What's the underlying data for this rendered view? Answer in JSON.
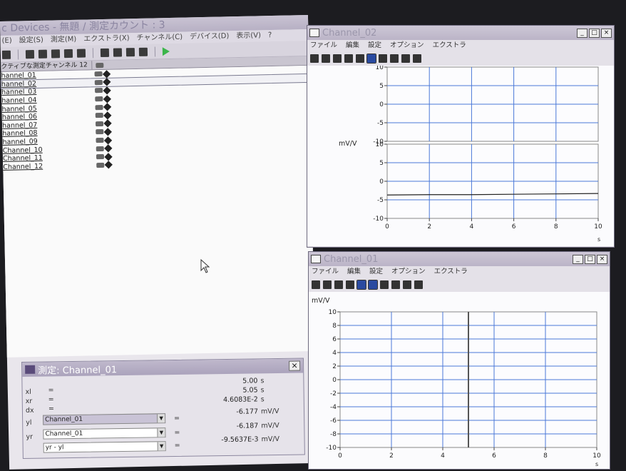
{
  "main": {
    "title": "c Devices - 無題 / 測定カウント : 3",
    "menu": [
      "(E)",
      "設定(S)",
      "測定(M)",
      "エクストラ(X)",
      "チャンネル(C)",
      "デバイス(D)",
      "表示(V)",
      "?"
    ],
    "list_header": "クティブな測定チャンネル 12",
    "channels": [
      "hannel_01",
      "hannel_02",
      "hannel_03",
      "hannel_04",
      "hannel_05",
      "hannel_06",
      "hannel_07",
      "hannel_08",
      "hannel_09",
      "Channel_10",
      "Channel_11",
      "Channel_12"
    ]
  },
  "measure": {
    "title": "測定: Channel_01",
    "close": "×",
    "rows": [
      {
        "label": "xl",
        "eq": "=",
        "value": "5.00",
        "unit": "s"
      },
      {
        "label": "xr",
        "eq": "=",
        "value": "5.05",
        "unit": "s"
      },
      {
        "label": "dx",
        "eq": "=",
        "value": "4.6083E-2",
        "unit": "s"
      }
    ],
    "yl": {
      "label": "yl",
      "channel": "Channel_01",
      "eq": "=",
      "value": "-6.177",
      "unit": "mV/V"
    },
    "yr": {
      "label": "yr",
      "channel": "Channel_01",
      "eq": "=",
      "value": "-6.187",
      "unit": "mV/V"
    },
    "diff": {
      "expr": "yr - yl",
      "eq": "=",
      "value": "-9.5637E-3",
      "unit": "mV/V"
    }
  },
  "ch02": {
    "title": "Channel_02",
    "menu": [
      "ファイル",
      "編集",
      "設定",
      "オプション",
      "エクストラ"
    ],
    "ylabel": "mV/V",
    "xlabel": "s",
    "buttons": [
      "_",
      "□",
      "×"
    ]
  },
  "ch01": {
    "title": "Channel_01",
    "menu": [
      "ファイル",
      "編集",
      "設定",
      "オプション",
      "エクストラ"
    ],
    "ylabel": "mV/V",
    "xlabel": "s",
    "buttons": [
      "_",
      "□",
      "×"
    ]
  },
  "chart_data": [
    {
      "type": "line",
      "panel": "Channel_02 upper",
      "ylabel": "",
      "ylim": [
        -10,
        10
      ],
      "yticks": [
        10,
        5,
        0,
        -5,
        -10
      ],
      "xlim": [
        0,
        10
      ],
      "series": []
    },
    {
      "type": "line",
      "panel": "Channel_02 lower",
      "ylabel": "mV/V",
      "ylim": [
        -10,
        10
      ],
      "yticks": [
        10,
        5,
        0,
        -5,
        -10
      ],
      "xlim": [
        0,
        10
      ],
      "xticks": [
        0,
        2,
        4,
        6,
        8,
        10
      ],
      "xlabel": "s",
      "series": [
        {
          "x": [
            0,
            2,
            4,
            6,
            8,
            10
          ],
          "values": [
            -3.7,
            -3.6,
            -3.6,
            -3.5,
            -3.4,
            -3.3
          ]
        }
      ]
    },
    {
      "type": "line",
      "panel": "Channel_01",
      "ylabel": "mV/V",
      "ylim": [
        -10,
        10
      ],
      "yticks": [
        10,
        8,
        6,
        4,
        2,
        0,
        -2,
        -4,
        -6,
        -8,
        -10
      ],
      "xlim": [
        0,
        10
      ],
      "xticks": [
        0,
        2,
        4,
        6,
        8,
        10
      ],
      "xlabel": "s",
      "cursor_x": 5.0,
      "series": []
    }
  ]
}
